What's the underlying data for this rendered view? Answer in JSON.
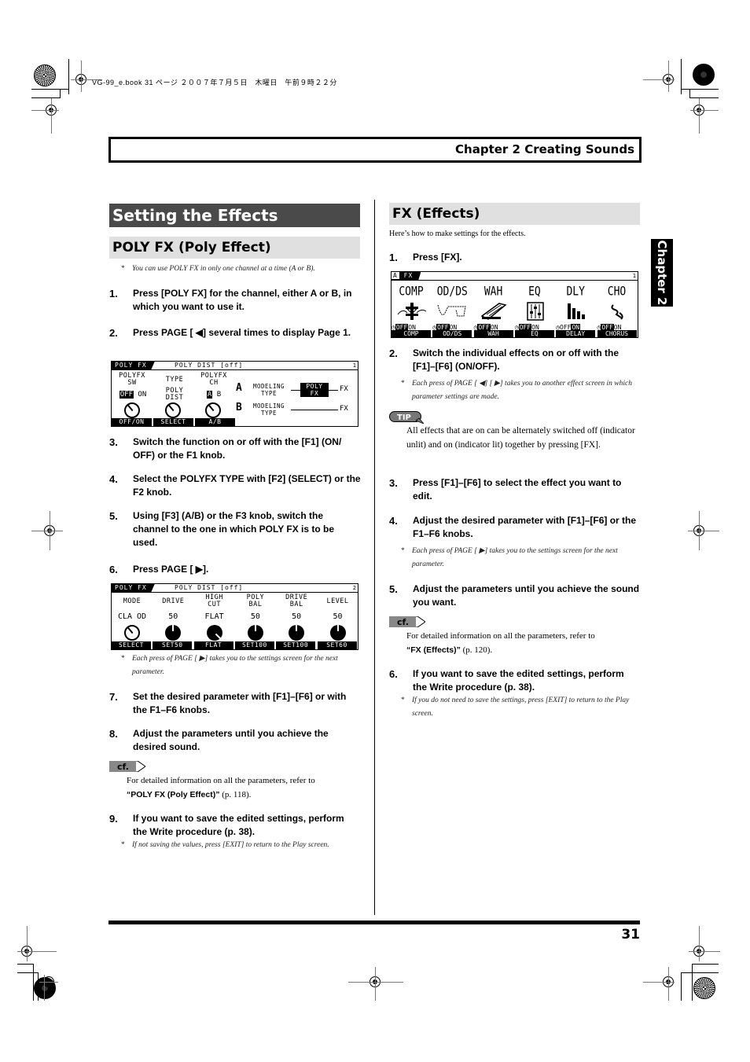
{
  "print_meta": "VG-99_e.book 31 ページ ２００７年７月５日　木曜日　午前９時２２分",
  "chapter_header": "Chapter 2 Creating Sounds",
  "side_tab": "Chapter 2",
  "page_number": "31",
  "left": {
    "section_title": "Setting the Effects",
    "subsection_title": "POLY FX (Poly Effect)",
    "note_top": "You can use POLY FX in only one channel at a time (A or B).",
    "steps": [
      {
        "num": "1.",
        "text": "Press [POLY FX] for the channel, either A or B, in which you want to use it."
      },
      {
        "num": "2.",
        "text": "Press PAGE [ ◀] several times to display Page 1."
      },
      {
        "num": "3.",
        "text": "Switch the function on or off with the [F1] (ON/ OFF) or the F1 knob."
      },
      {
        "num": "4.",
        "text": "Select the POLYFX TYPE with [F2] (SELECT) or the F2 knob."
      },
      {
        "num": "5.",
        "text": "Using [F3] (A/B) or the F3 knob, switch the channel to the one in which POLY FX is to be used."
      },
      {
        "num": "6.",
        "text": "Press PAGE [ ▶]."
      },
      {
        "num": "7.",
        "text": "Set the desired parameter with [F1]–[F6] or with the F1–F6 knobs."
      },
      {
        "num": "8.",
        "text": "Adjust the parameters until you achieve the desired sound."
      },
      {
        "num": "9.",
        "text": "If you want to save the edited settings, perform the Write procedure (p. 38)."
      }
    ],
    "note_page": "Each press of PAGE [ ▶] takes you to the settings screen for the next parameter.",
    "cf_label": "cf.",
    "cf_text": "For detailed information on all the parameters, refer to",
    "cf_ref": "“POLY FX (Poly Effect)”",
    "cf_page": "(p. 118).",
    "note_bottom": "If not saving the values, press [EXIT] to return to the Play screen.",
    "lcd1": {
      "title": "POLY FX",
      "subtitle": "POLY DIST [off]",
      "page": "1",
      "col1_label": "POLYFX\nSW",
      "col1_off": "OFF",
      "col1_on": "ON",
      "col2_label": "TYPE",
      "col2_value": "POLY\nDIST",
      "col3_label": "POLYFX\nCH",
      "col3_a": "A",
      "col3_b": "B",
      "route_a": "A",
      "route_b": "B",
      "modeling_type": "MODELING\nTYPE",
      "poly_fx_block": "POLY\nFX",
      "fx_out": "FX",
      "footer": [
        "OFF/ON",
        "SELECT",
        "A/B"
      ]
    },
    "lcd2": {
      "title": "POLY FX",
      "subtitle": "POLY DIST [off]",
      "page": "2",
      "params": [
        {
          "label": "MODE",
          "value": "CLA OD",
          "footer": "SELECT"
        },
        {
          "label": "DRIVE",
          "value": "50",
          "footer": "SET50"
        },
        {
          "label": "HIGH\nCUT",
          "value": "FLAT",
          "footer": "FLAT"
        },
        {
          "label": "POLY\nBAL",
          "value": "50",
          "footer": "SET100"
        },
        {
          "label": "DRIVE\nBAL",
          "value": "50",
          "footer": "SET100"
        },
        {
          "label": "LEVEL",
          "value": "50",
          "footer": "SET60"
        }
      ]
    }
  },
  "right": {
    "subsection_title": "FX (Effects)",
    "intro": "Here’s how to make settings for the effects.",
    "steps": [
      {
        "num": "1.",
        "text": "Press [FX]."
      },
      {
        "num": "2.",
        "text": "Switch the individual effects on or off with the [F1]–[F6] (ON/OFF)."
      },
      {
        "num": "3.",
        "text": "Press [F1]–[F6] to select the effect you want to edit."
      },
      {
        "num": "4.",
        "text": "Adjust the desired parameter with [F1]–[F6] or the F1–F6 knobs."
      },
      {
        "num": "5.",
        "text": "Adjust the parameters until you achieve the sound you want."
      },
      {
        "num": "6.",
        "text": "If you want to save the edited settings, perform the Write procedure (p. 38)."
      }
    ],
    "note_step2": "Each press of PAGE [ ◀] [ ▶] takes you to another effect screen in which parameter settings are made.",
    "tip_label": "TIP",
    "tip_text": "All effects that are on can be alternately switched off (indicator unlit) and on (indicator lit) together by pressing [FX].",
    "note_step4": "Each press of PAGE [ ▶] takes you to the settings screen for the next parameter.",
    "cf_label": "cf.",
    "cf_text": "For detailed information on all the parameters, refer to",
    "cf_ref": "“FX (Effects)”",
    "cf_page": "(p. 120).",
    "note_bottom": "If you do not need to save the settings, press [EXIT] to return to the Play screen.",
    "lcd": {
      "channel": "A",
      "title": "FX",
      "page": "1",
      "effects": [
        {
          "name": "COMP",
          "icon": "compressor-icon",
          "off": "OFF",
          "on": "ON",
          "state": "off",
          "footer": "COMP"
        },
        {
          "name": "OD/DS",
          "icon": "overdrive-icon",
          "off": "OFF",
          "on": "ON",
          "state": "off",
          "footer": "OD/DS"
        },
        {
          "name": "WAH",
          "icon": "wah-pedal-icon",
          "off": "OFF",
          "on": "ON",
          "state": "off",
          "footer": "WAH"
        },
        {
          "name": "EQ",
          "icon": "eq-sliders-icon",
          "off": "OFF",
          "on": "ON",
          "state": "off",
          "footer": "EQ"
        },
        {
          "name": "DLY",
          "icon": "delay-bars-icon",
          "off": "OFF",
          "on": "ON",
          "state": "on",
          "footer": "DELAY"
        },
        {
          "name": "CHO",
          "icon": "chorus-icon",
          "off": "OFF",
          "on": "ON",
          "state": "off",
          "footer": "CHORUS"
        }
      ]
    }
  }
}
